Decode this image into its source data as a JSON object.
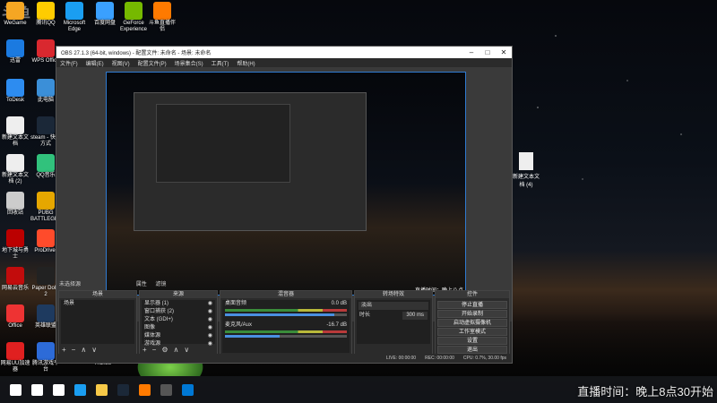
{
  "watermark": "斗鱼",
  "desktop": {
    "icons": [
      {
        "label": "WeGame",
        "color": "#f5a623"
      },
      {
        "label": "腾讯QQ",
        "color": "#ffcc00"
      },
      {
        "label": "Microsoft Edge",
        "color": "#1a9ef2"
      },
      {
        "label": "百度网盘",
        "color": "#3aa0ff"
      },
      {
        "label": "GeForce Experience",
        "color": "#76b900"
      },
      {
        "label": "斗鱼直播伴侣",
        "color": "#ff7a00"
      },
      {
        "label": "迅雷",
        "color": "#1b7ae0"
      },
      {
        "label": "WPS Office",
        "color": "#d9282f"
      },
      {
        "label": "ToDesk",
        "color": "#2d8cf0"
      },
      {
        "label": "此电脑",
        "color": "#3b8fd8"
      },
      {
        "label": "新建文本文档",
        "color": "#eee"
      },
      {
        "label": "steam - 快捷方式",
        "color": "#1b2838"
      },
      {
        "label": "新建文本文档 (2)",
        "color": "#eee"
      },
      {
        "label": "QQ音乐",
        "color": "#31c27c"
      },
      {
        "label": "回收站",
        "color": "#ccc"
      },
      {
        "label": "PUBG BATTLEGROUNDS",
        "color": "#e6a700"
      },
      {
        "label": "地下城与勇士",
        "color": "#b00"
      },
      {
        "label": "ProDriver",
        "color": "#ff4b2b"
      },
      {
        "label": "网易云音乐",
        "color": "#c20c0c"
      },
      {
        "label": "Paper Dolls 2",
        "color": "#222"
      },
      {
        "label": "Office",
        "color": "#e33"
      },
      {
        "label": "英雄联盟",
        "color": "#1e3a5f"
      },
      {
        "label": "网易UU加速器",
        "color": "#e02020"
      },
      {
        "label": "腾讯游戏平台",
        "color": "#2d6bd8"
      },
      {
        "label": "iTunes",
        "color": "#ff5ea8"
      }
    ]
  },
  "right_file": {
    "label": "新建文本文档 (4)"
  },
  "obs": {
    "title": "OBS 27.1.3 (64-bit, windows) - 配置文件: 未命名 - 场景: 未命名",
    "menu": [
      "文件(F)",
      "编辑(E)",
      "视图(V)",
      "配置文件(P)",
      "场景集合(S)",
      "工具(T)",
      "帮助(H)"
    ],
    "preview_text": "直播时间：晚上八点",
    "source_bar": "未选择源",
    "props_btn": "属性",
    "filters_btn": "滤镜",
    "docks": {
      "scenes": {
        "title": "场景",
        "items": [
          "场景"
        ]
      },
      "sources": {
        "title": "来源",
        "items": [
          "显示器 (1)",
          "窗口捕获 (2)",
          "文本 (GDI+)",
          "图像",
          "媒体源",
          "游戏源"
        ]
      },
      "mixer": {
        "title": "混音器",
        "tracks": [
          {
            "name": "桌面音频",
            "db": "0.0 dB"
          },
          {
            "name": "麦克风/Aux",
            "db": "-16.7 dB"
          }
        ]
      },
      "transitions": {
        "title": "转场特效",
        "type": "淡出",
        "duration_label": "时长",
        "duration": "300 ms"
      },
      "controls": {
        "title": "控件",
        "buttons": [
          "停止直播",
          "开始录制",
          "启动虚拟摄像机",
          "工作室模式",
          "设置",
          "退出"
        ]
      }
    },
    "status": {
      "live": "LIVE: 00:00:00",
      "rec": "REC: 00:00:00",
      "cpu": "CPU: 0.7%, 30.00 fps"
    }
  },
  "taskbar": {
    "items": [
      {
        "name": "start-icon",
        "color": "#fff"
      },
      {
        "name": "search-icon",
        "color": "#fff"
      },
      {
        "name": "task-view-icon",
        "color": "#fff"
      },
      {
        "name": "edge-icon",
        "color": "#1a9ef2"
      },
      {
        "name": "file-explorer-icon",
        "color": "#f7c948"
      },
      {
        "name": "steam-icon",
        "color": "#1b2838"
      },
      {
        "name": "douyu-icon",
        "color": "#ff7a00"
      },
      {
        "name": "obs-icon",
        "color": "#555"
      },
      {
        "name": "store-icon",
        "color": "#0078d4"
      }
    ]
  },
  "live_banner": "直播时间：晚上8点30开始"
}
